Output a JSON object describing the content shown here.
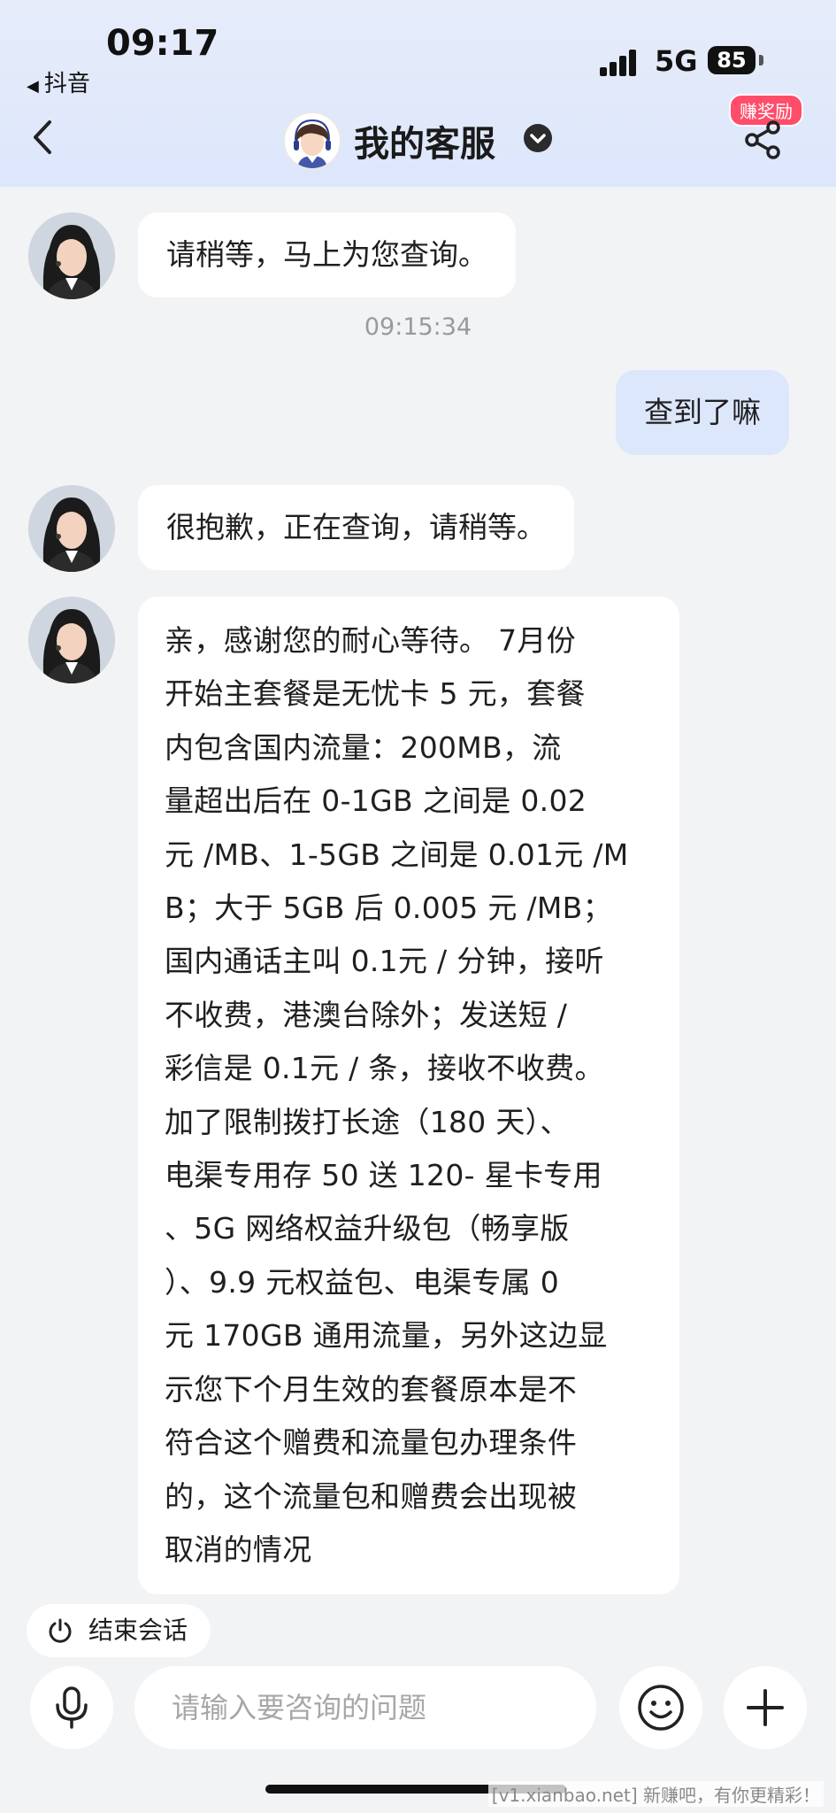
{
  "status_bar": {
    "time": "09:17",
    "back_app": "抖音",
    "network": "5G",
    "battery": "85"
  },
  "header": {
    "title": "我的客服",
    "reward_badge": "赚奖励",
    "icons": [
      "back-icon",
      "verified-icon",
      "share-icon"
    ]
  },
  "messages": [
    {
      "sender": "agent",
      "text": "请稍等，马上为您查询。"
    },
    {
      "type": "timestamp",
      "text": "09:15:34"
    },
    {
      "sender": "user",
      "text": "查到了嘛"
    },
    {
      "sender": "agent",
      "text": "很抱歉，正在查询，请稍等。"
    },
    {
      "sender": "agent",
      "lines": [
        "亲，感谢您的耐心等待。 7月份",
        "开始主套餐是无忧卡 5 元，套餐",
        "内包含国内流量：200MB，流",
        "量超出后在 0-1GB 之间是 0.02",
        "元 /MB、1-5GB 之间是 0.01元 /M",
        "B；大于 5GB 后 0.005 元 /MB；",
        "国内通话主叫 0.1元 / 分钟，接听",
        "不收费，港澳台除外；发送短 /",
        "彩信是 0.1元 / 条，接收不收费。",
        "加了限制拨打长途（180 天）、",
        "电渠专用存 50 送 120- 星卡专用",
        "、5G 网络权益升级包（畅享版",
        "）、9.9 元权益包、电渠专属 0",
        "元 170GB 通用流量，另外这边显",
        "示您下个月生效的套餐原本是不",
        "符合这个赠费和流量包办理条件",
        "的，这个流量包和赠费会出现被",
        "取消的情况"
      ]
    }
  ],
  "bottom": {
    "end_session": "结束会话",
    "input_placeholder": "请输入要咨询的问题",
    "icons": [
      "power-icon",
      "microphone-icon",
      "emoji-icon",
      "plus-icon"
    ]
  },
  "watermark": "[v1.xianbao.net] 新赚吧，有你更精彩！",
  "colors": {
    "header_bg": "#dde6fb",
    "page_bg": "#f2f3f5",
    "user_bubble": "#dde7fb",
    "agent_bubble": "#ffffff",
    "reward_badge": "#ff4d6a"
  }
}
